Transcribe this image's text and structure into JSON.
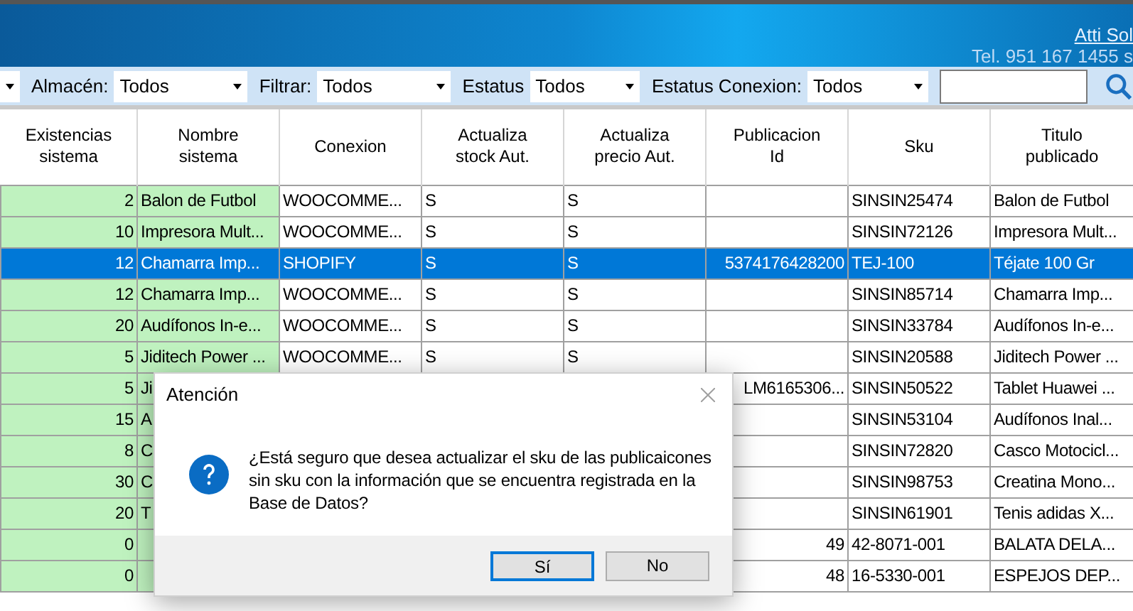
{
  "banner": {
    "link": "Atti Sol",
    "phone": "Tel. 951 167 1455  s"
  },
  "filters": [
    {
      "kind": "stub"
    },
    {
      "kind": "select",
      "label": "Almacén:",
      "value": "Todos"
    },
    {
      "kind": "select",
      "label": "Filtrar:",
      "value": "Todos"
    },
    {
      "kind": "select",
      "label": "Estatus",
      "value": "Todos"
    },
    {
      "kind": "select",
      "label": "Estatus Conexion:",
      "value": "Todos"
    },
    {
      "kind": "search"
    }
  ],
  "table": {
    "columns": [
      {
        "heading": "Existencias sistema",
        "kind": "number"
      },
      {
        "heading": "Nombre sistema",
        "kind": "system"
      },
      {
        "heading": "Conexion",
        "kind": "text"
      },
      {
        "heading": "Actualiza stock Aut.",
        "kind": "text"
      },
      {
        "heading": "Actualiza precio Aut.",
        "kind": "text"
      },
      {
        "heading": "Publicacion Id",
        "kind": "right"
      },
      {
        "heading": "Sku",
        "kind": "text"
      },
      {
        "heading": "Titulo publicado",
        "kind": "text"
      }
    ],
    "rows": [
      {
        "selected": false,
        "cells": [
          "2",
          "Balon de Futbol",
          "WOOCOMME...",
          "S",
          "S",
          null,
          "SINSIN25474",
          "Balon de Futbol"
        ]
      },
      {
        "selected": false,
        "cells": [
          "10",
          "Impresora Mult...",
          "WOOCOMME...",
          "S",
          "S",
          null,
          "SINSIN72126",
          "Impresora Mult..."
        ]
      },
      {
        "selected": true,
        "cells": [
          "12",
          "Chamarra Imp...",
          "SHOPIFY",
          "S",
          "S",
          "5374176428200",
          "TEJ-100",
          "Téjate 100 Gr"
        ]
      },
      {
        "selected": false,
        "cells": [
          "12",
          "Chamarra Imp...",
          "WOOCOMME...",
          "S",
          "S",
          null,
          "SINSIN85714",
          "Chamarra Imp..."
        ]
      },
      {
        "selected": false,
        "cells": [
          "20",
          "Audífonos In-e...",
          "WOOCOMME...",
          "S",
          "S",
          null,
          "SINSIN33784",
          "Audífonos In-e..."
        ]
      },
      {
        "selected": false,
        "cells": [
          "5",
          "Jiditech Power ...",
          "WOOCOMME...",
          "S",
          "S",
          null,
          "SINSIN20588",
          "Jiditech Power ..."
        ]
      },
      {
        "selected": false,
        "cells": [
          "5",
          "Ji",
          null,
          null,
          null,
          "LM6165306...",
          "SINSIN50522",
          "Tablet Huawei ..."
        ]
      },
      {
        "selected": false,
        "cells": [
          "15",
          "A",
          null,
          null,
          null,
          null,
          "SINSIN53104",
          "Audífonos Inal..."
        ]
      },
      {
        "selected": false,
        "cells": [
          "8",
          "C",
          null,
          null,
          null,
          null,
          "SINSIN72820",
          "Casco Motocicl..."
        ]
      },
      {
        "selected": false,
        "cells": [
          "30",
          "C",
          null,
          null,
          null,
          null,
          "SINSIN98753",
          "Creatina Mono..."
        ]
      },
      {
        "selected": false,
        "cells": [
          "20",
          "T",
          null,
          null,
          null,
          null,
          "SINSIN61901",
          "Tenis adidas X..."
        ]
      },
      {
        "selected": false,
        "cells": [
          "0",
          null,
          null,
          null,
          null,
          "49",
          "42-8071-001",
          "BALATA DELA..."
        ]
      },
      {
        "selected": false,
        "cells": [
          "0",
          null,
          null,
          null,
          null,
          "48",
          "16-5330-001",
          "ESPEJOS DEP..."
        ]
      }
    ]
  },
  "dialog": {
    "title": "Atención",
    "message": "¿Está seguro que desea actualizar el sku de las publicaicones sin sku con la información que se encuentra registrada en la Base de Datos?",
    "buttons": [
      {
        "label": "Sí",
        "default": true
      },
      {
        "label": "No",
        "default": false
      }
    ]
  }
}
